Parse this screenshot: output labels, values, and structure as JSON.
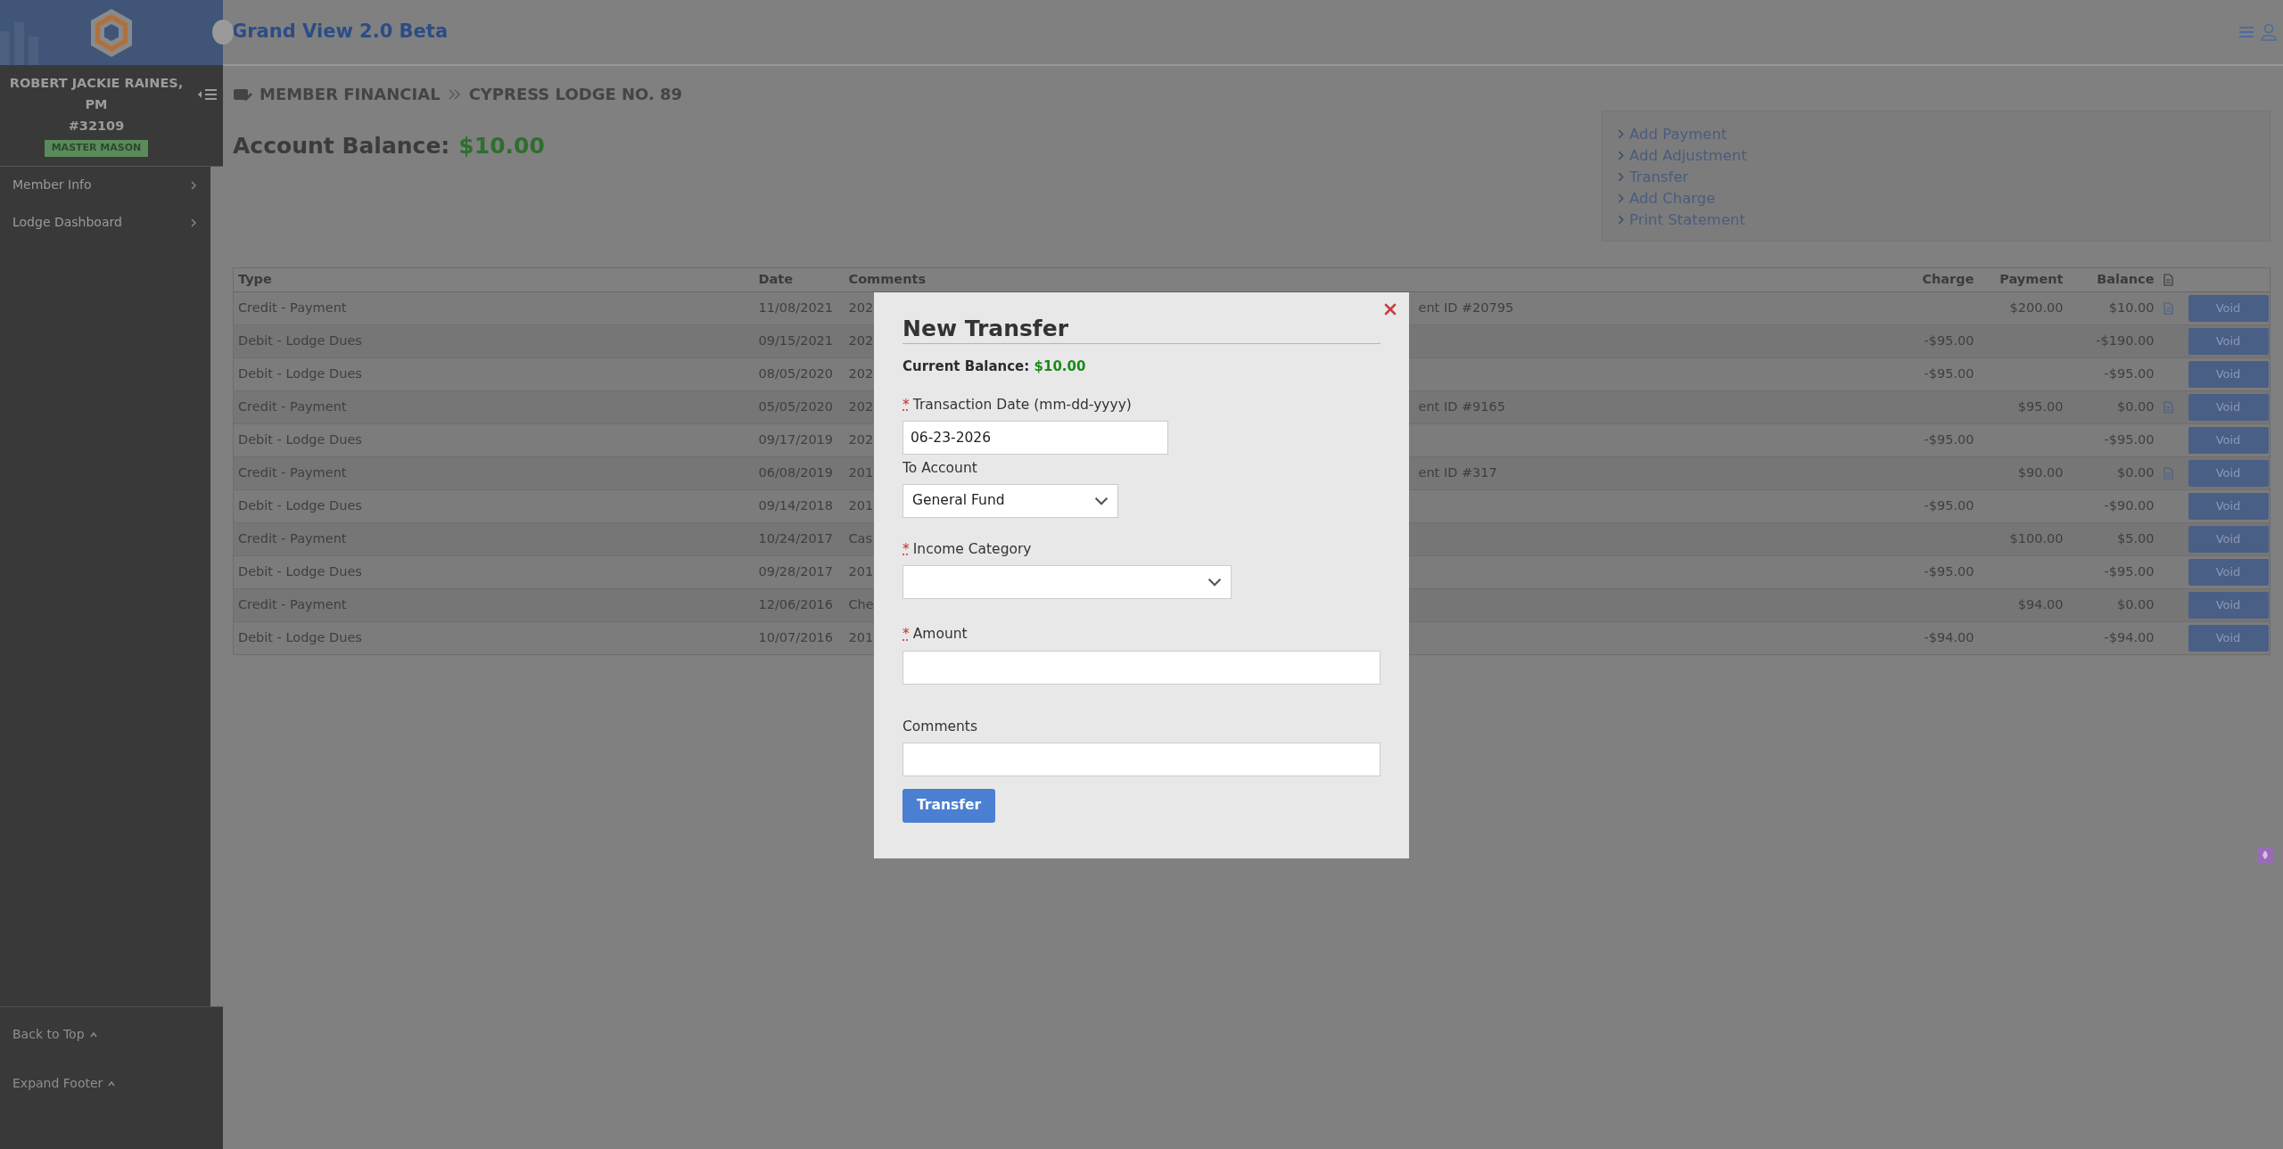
{
  "app": {
    "title": "Grand View 2.0 Beta"
  },
  "sidebar": {
    "member_name": "ROBERT JACKIE RAINES, PM",
    "member_number": "#32109",
    "badge": "MASTER MASON",
    "nav_items": [
      {
        "label": "Member Info"
      },
      {
        "label": "Lodge Dashboard"
      }
    ],
    "footer_links": [
      "Back to Top",
      "Expand Footer"
    ]
  },
  "breadcrumb": [
    "MEMBER FINANCIAL",
    "CYPRESS LODGE NO. 89"
  ],
  "account_balance": {
    "label": "Account Balance:",
    "value": "$10.00"
  },
  "actions": [
    "Add Payment",
    "Add Adjustment",
    "Transfer",
    "Add Charge",
    "Print Statement"
  ],
  "table": {
    "columns": [
      "Type",
      "Date",
      "Comments",
      "Charge",
      "Payment",
      "Balance"
    ],
    "rows": [
      {
        "type": "Credit - Payment",
        "date": "11/08/2021",
        "comments": "202",
        "column_4": "ent ID #20795",
        "payment": "$200.00",
        "balance": "$10.00",
        "receipt": true,
        "action": "Void"
      },
      {
        "type": "Debit - Lodge Dues",
        "date": "09/15/2021",
        "comments": "202",
        "charge": "-$95.00",
        "balance": "-$190.00",
        "receipt": false,
        "action": "Void"
      },
      {
        "type": "Debit - Lodge Dues",
        "date": "08/05/2020",
        "comments": "202",
        "charge": "-$95.00",
        "balance": "-$95.00",
        "receipt": false,
        "action": "Void"
      },
      {
        "type": "Credit - Payment",
        "date": "05/05/2020",
        "comments": "202",
        "column_4": "ent ID #9165",
        "payment": "$95.00",
        "balance": "$0.00",
        "receipt": true,
        "action": "Void"
      },
      {
        "type": "Debit - Lodge Dues",
        "date": "09/17/2019",
        "comments": "202",
        "charge": "-$95.00",
        "balance": "-$95.00",
        "receipt": false,
        "action": "Void"
      },
      {
        "type": "Credit - Payment",
        "date": "06/08/2019",
        "comments": "201",
        "column_4": "ent ID #317",
        "payment": "$90.00",
        "balance": "$0.00",
        "receipt": true,
        "action": "Void"
      },
      {
        "type": "Debit - Lodge Dues",
        "date": "09/14/2018",
        "comments": "201",
        "charge": "-$95.00",
        "balance": "-$90.00",
        "receipt": false,
        "action": "Void"
      },
      {
        "type": "Credit - Payment",
        "date": "10/24/2017",
        "comments": "Cas",
        "payment": "$100.00",
        "balance": "$5.00",
        "receipt": false,
        "action": "Void"
      },
      {
        "type": "Debit - Lodge Dues",
        "date": "09/28/2017",
        "comments": "201",
        "charge": "-$95.00",
        "balance": "-$95.00",
        "receipt": false,
        "action": "Void"
      },
      {
        "type": "Credit - Payment",
        "date": "12/06/2016",
        "comments": "Che",
        "payment": "$94.00",
        "balance": "$0.00",
        "receipt": false,
        "action": "Void"
      },
      {
        "type": "Debit - Lodge Dues",
        "date": "10/07/2016",
        "comments": "201",
        "charge": "-$94.00",
        "balance": "-$94.00",
        "receipt": false,
        "action": "Void"
      }
    ]
  },
  "modal": {
    "title": "New Transfer",
    "current_balance": {
      "label": "Current Balance:",
      "value": "$10.00"
    },
    "required_mark": "*",
    "fields": [
      {
        "kind": "date",
        "label": "Transaction Date (mm-dd-yyyy)",
        "required": true,
        "value": "06-23-2026"
      },
      {
        "kind": "select",
        "label": "To Account",
        "required": false,
        "value": "General Fund"
      },
      {
        "kind": "select",
        "label": "Income Category",
        "required": true
      },
      {
        "kind": "text",
        "label": "Amount",
        "required": true
      },
      {
        "kind": "text",
        "label": "Comments",
        "required": false
      }
    ],
    "submit": "Transfer"
  }
}
